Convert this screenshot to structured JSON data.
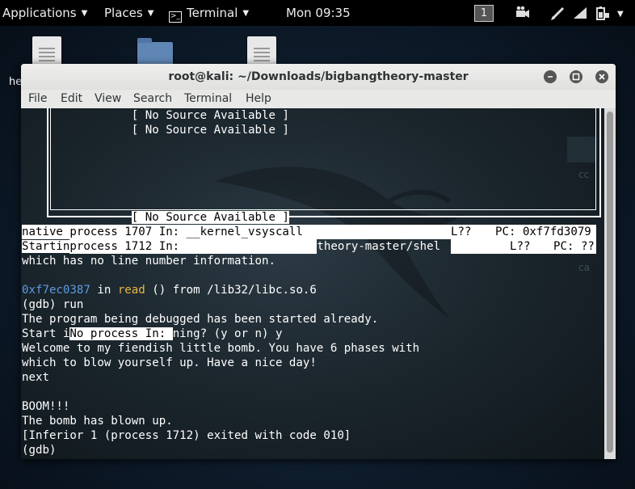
{
  "topbar": {
    "applications": "Applications",
    "places": "Places",
    "terminal": "Terminal",
    "clock": "Mon 09:35",
    "workspace": "1"
  },
  "desktop": {
    "partial_label": "he"
  },
  "window": {
    "title": "root@kali: ~/Downloads/bigbangtheory-master",
    "menus": [
      "File",
      "Edit",
      "View",
      "Search",
      "Terminal",
      "Help"
    ]
  },
  "terminal": {
    "no_source_1": "[ No Source Available ]",
    "no_source_2": "[ No Source Available ]",
    "no_source_3": "[ No Source Available ]",
    "status1": {
      "text": "native process 1707 In: __kernel_vsyscall",
      "line": "L??",
      "pc": "PC: 0xf7fd3079"
    },
    "status2": {
      "start": "Startin",
      "text": "process 1712 In:",
      "path": "theory-master/shel",
      "line": "L??",
      "pc": "PC: ??"
    },
    "line_noinfo": "which has no line number information.",
    "frame_addr": "0xf7ec0387",
    "frame_in": " in ",
    "frame_func": "read",
    "frame_rest": " () from /lib32/libc.so.6",
    "line_run": "(gdb) run",
    "line_started": "The program being debugged has been started already.",
    "line_start_a": "Start i",
    "line_start_popup": "No process In: ",
    "line_start_b": "ning? (y or n) y",
    "line_welcome": "Welcome to my fiendish little bomb. You have 6 phases with",
    "line_blow": "which to blow yourself up. Have a nice day!",
    "line_next": "next",
    "line_boom": "BOOM!!!",
    "line_blown": "The bomb has blown up.",
    "line_exited": "[Inferior 1 (process 1712) exited with code 010]",
    "line_prompt": "(gdb)",
    "bg_label_1": "cc",
    "bg_label_2": "ca"
  },
  "icons": {
    "applications": "chevron-down-icon",
    "tray": [
      "camera-icon",
      "pen-icon",
      "volume-icon",
      "battery-icon",
      "power-menu-icon"
    ]
  }
}
